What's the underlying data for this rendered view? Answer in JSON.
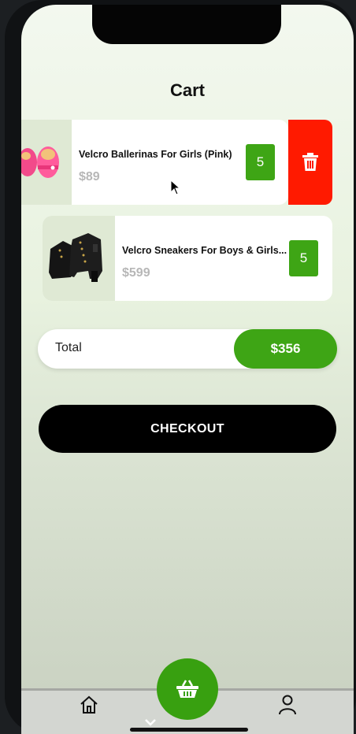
{
  "page": {
    "title": "Cart"
  },
  "cart": {
    "items": [
      {
        "name": "Velcro Ballerinas For Girls  (Pink)",
        "price": "$89",
        "quantity": "5",
        "image": "pink-ballerina-shoes"
      },
      {
        "name": "Velcro Sneakers For Boys & Girls...",
        "price": "$599",
        "quantity": "5",
        "image": "black-lace-up-boots"
      }
    ]
  },
  "summary": {
    "label": "Total",
    "amount": "$356"
  },
  "checkout": {
    "label": "CHECKOUT"
  },
  "nav": {
    "items": [
      "home-icon",
      "basket-icon",
      "user-icon"
    ]
  },
  "colors": {
    "accent": "#3ea515",
    "delete": "#ff1a00",
    "checkout_bg": "#000000"
  }
}
